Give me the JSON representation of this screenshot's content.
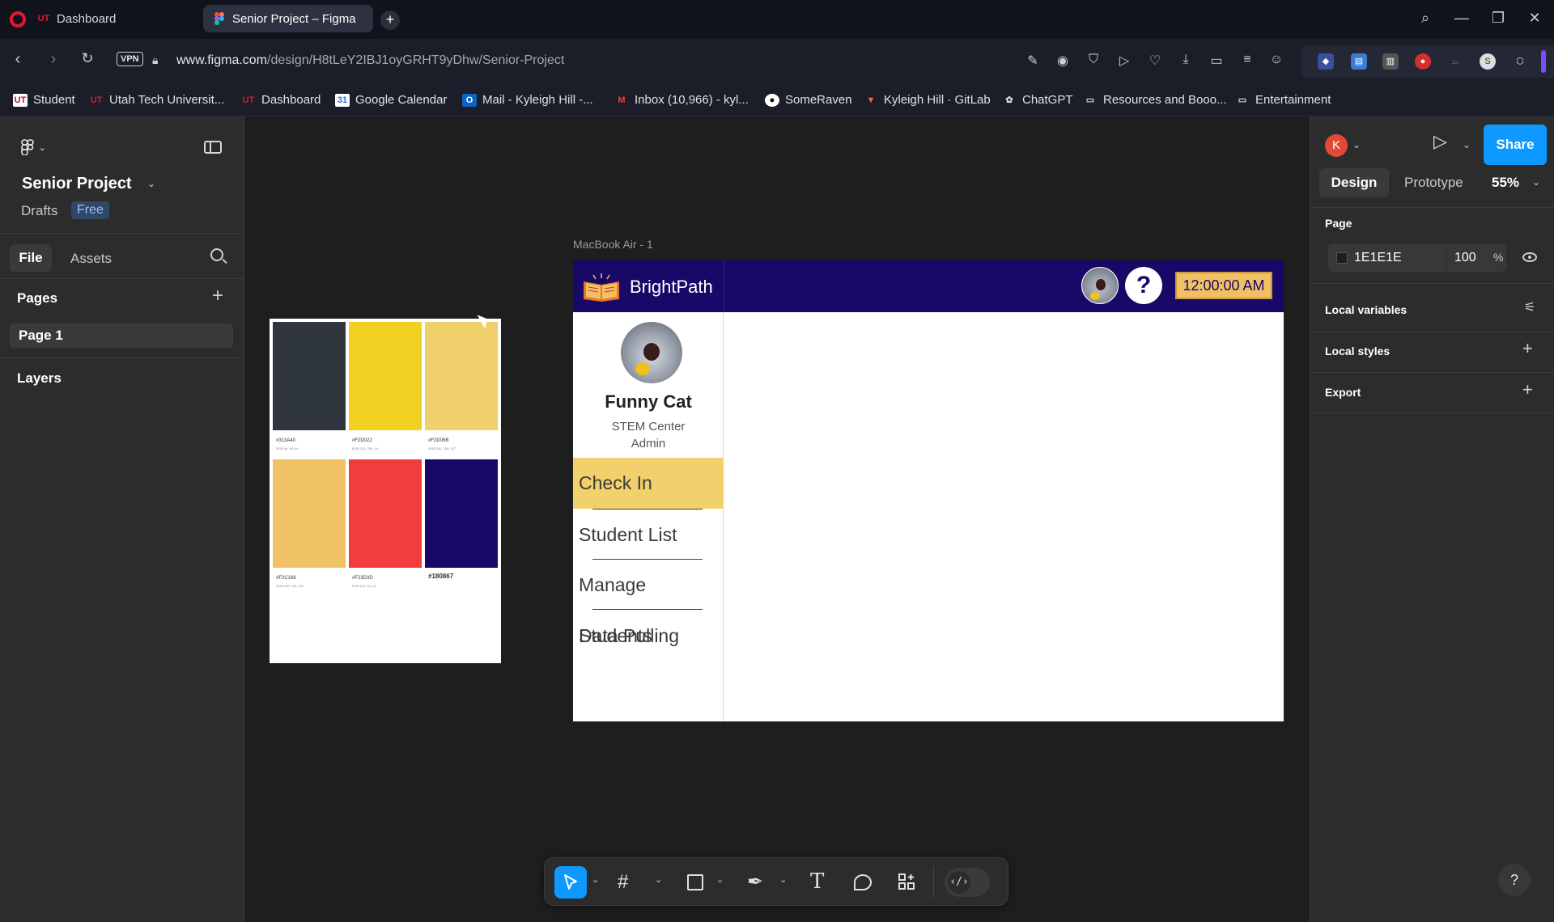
{
  "browser": {
    "tabs": [
      {
        "label": "Dashboard",
        "favicon": "UT"
      },
      {
        "label": "Senior Project – Figma"
      }
    ],
    "url_host": "www.figma.com",
    "url_path": "/design/H8tLeY2IBJ1oyGRHT9yDhw/Senior-Project",
    "vpn_label": "VPN",
    "bookmarks": [
      {
        "label": "Student",
        "icon": "UT"
      },
      {
        "label": "Utah Tech Universit...",
        "icon": "UT"
      },
      {
        "label": "Dashboard",
        "icon": "UT"
      },
      {
        "label": "Google Calendar",
        "icon": "31"
      },
      {
        "label": "Mail - Kyleigh Hill -...",
        "icon": "O"
      },
      {
        "label": "Inbox (10,966) - kyl...",
        "icon": "M"
      },
      {
        "label": "SomeRaven",
        "icon": "github-icon"
      },
      {
        "label": "Kyleigh Hill · GitLab",
        "icon": "gitlab-icon"
      },
      {
        "label": "ChatGPT",
        "icon": "chatgpt-icon"
      },
      {
        "label": "Resources and Booo...",
        "icon": "folder-icon"
      },
      {
        "label": "Entertainment",
        "icon": "folder-icon"
      }
    ]
  },
  "left_panel": {
    "project_name": "Senior Project",
    "drafts_label": "Drafts",
    "plan_badge": "Free",
    "tabs": {
      "file": "File",
      "assets": "Assets"
    },
    "pages_title": "Pages",
    "pages": [
      "Page 1"
    ],
    "layers_title": "Layers"
  },
  "right_panel": {
    "avatar_initial": "K",
    "share_label": "Share",
    "tabs": {
      "design": "Design",
      "prototype": "Prototype"
    },
    "zoom": "55%",
    "page_title": "Page",
    "page_color": "1E1E1E",
    "page_opacity": "100",
    "percent_sign": "%",
    "local_variables": "Local variables",
    "local_styles": "Local styles",
    "export": "Export",
    "help": "?"
  },
  "canvas": {
    "palette": {
      "swatches": [
        {
          "hex": "#313A40",
          "color": "#2f363d",
          "sub": "RGB 49, 58, 64"
        },
        {
          "hex": "#F2D022",
          "color": "#f2d022",
          "sub": "RGB 242, 208, 34"
        },
        {
          "hex": "#F2D06B",
          "color": "#f0d06b",
          "sub": "RGB 242, 208, 107"
        },
        {
          "hex": "#F2C166",
          "color": "#f1c166",
          "sub": "RGB 242, 193, 102"
        },
        {
          "hex": "#F23D3D",
          "color": "#f23d3d",
          "sub": "RGB 242, 61, 61"
        },
        {
          "hex": "#180867",
          "color": "#180867",
          "sub": ""
        }
      ]
    },
    "frame_label": "MacBook Air - 1",
    "app": {
      "brand": "BrightPath",
      "clock": "12:00:00 AM",
      "help_glyph": "?",
      "profile": {
        "name": "Funny Cat",
        "org": "STEM Center",
        "role": "Admin"
      },
      "nav": [
        "Check In",
        "Student List",
        "Manage Students",
        "Data Pulling"
      ]
    }
  },
  "colors": {
    "figma_blue": "#0d99ff",
    "navy": "#180867",
    "gold": "#f2d06b"
  }
}
